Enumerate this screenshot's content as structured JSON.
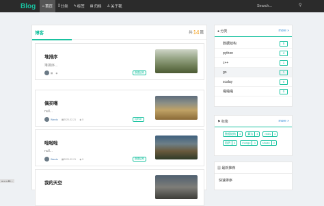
{
  "nav": {
    "logo": "Blog",
    "items": [
      {
        "icon": "home-icon",
        "glyph": "⌂",
        "label": "首页",
        "active": true
      },
      {
        "icon": "category-icon",
        "glyph": "⁑",
        "label": "分类"
      },
      {
        "icon": "tag-icon",
        "glyph": "✎",
        "label": "标签"
      },
      {
        "icon": "archive-icon",
        "glyph": "▤",
        "label": "归档"
      },
      {
        "icon": "user-icon",
        "glyph": "♙",
        "label": "关于我"
      }
    ],
    "search_placeholder": "Search...",
    "search_icon": "search-icon"
  },
  "main": {
    "title": "博客",
    "count_prefix": "共",
    "count": "14",
    "count_suffix": "篇",
    "posts": [
      {
        "title": "堆排序",
        "summary": "堆排序...",
        "author": "",
        "date": "",
        "views": "",
        "tag": "数据结构",
        "thumb": "wheat-field"
      },
      {
        "title": "偶买噶",
        "summary": "null...",
        "author": "Wandu",
        "date": "2020-02-21",
        "views": "5",
        "tag": "python",
        "thumb": "grass-field"
      },
      {
        "title": "啦啦啦",
        "summary": "null...",
        "author": "Wandu",
        "date": "2020-02-21",
        "views": "5",
        "tag": "数据结构",
        "thumb": "tuscany-hills"
      },
      {
        "title": "我的天空",
        "summary": "",
        "author": "",
        "date": "",
        "views": "",
        "tag": "",
        "thumb": "sky"
      }
    ]
  },
  "side": {
    "categories": {
      "title": "分类",
      "more": "more »",
      "items": [
        {
          "name": "数据结构",
          "count": "5"
        },
        {
          "name": "python",
          "count": "4"
        },
        {
          "name": "c++",
          "count": "1"
        },
        {
          "name": "go",
          "count": "1"
        },
        {
          "name": "scalay",
          "count": "0"
        },
        {
          "name": "啪啪啪",
          "count": "0"
        }
      ]
    },
    "tags": {
      "title": "标签",
      "more": "more »",
      "items": [
        {
          "name": "数据结构",
          "count": "4"
        },
        {
          "name": "算法",
          "count": "4"
        },
        {
          "name": "redis",
          "count": "4"
        },
        {
          "name": "陷阱",
          "count": "3"
        },
        {
          "name": "mongo",
          "count": "3"
        },
        {
          "name": "shuan",
          "count": "0"
        }
      ]
    },
    "recommend": {
      "title": "最新推荐",
      "items": [
        "快速排序"
      ]
    }
  },
  "corner_text": "o.c.o.Bl...",
  "colors": {
    "accent": "#19c2a0",
    "nav_bg": "#2b2b2b",
    "count": "#f39c12",
    "link": "#3a8fd8"
  }
}
